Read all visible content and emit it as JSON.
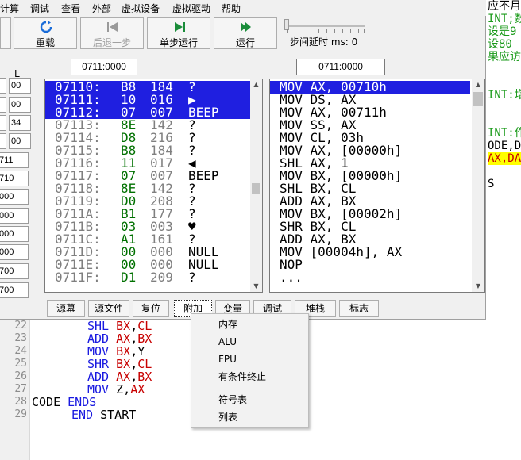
{
  "menubar": {
    "items": [
      "计算",
      "调试",
      "查看",
      "外部",
      "虚拟设备",
      "虚拟驱动",
      "帮助"
    ]
  },
  "toolbar": {
    "reload_label": "重载",
    "step_back_label": "后退一步",
    "step_run_label": "单步运行",
    "run_label": "运行",
    "step_delay_label": "步间延时 ms: 0"
  },
  "address": {
    "memory": "0711:0000",
    "disasm": "0711:0000"
  },
  "registers": {
    "header_l": "L",
    "values_l": [
      "00",
      "00",
      "34",
      "00"
    ],
    "values": [
      "711",
      "710",
      "000",
      "000",
      "000",
      "000",
      "700",
      "700"
    ]
  },
  "memory": {
    "rows": [
      {
        "addr": "07110:",
        "hex": "B8",
        "dec": "184",
        "chr": "?"
      },
      {
        "addr": "07111:",
        "hex": "10",
        "dec": "016",
        "chr": "▶"
      },
      {
        "addr": "07112:",
        "hex": "07",
        "dec": "007",
        "chr": "BEEP"
      },
      {
        "addr": "07113:",
        "hex": "8E",
        "dec": "142",
        "chr": "?"
      },
      {
        "addr": "07114:",
        "hex": "D8",
        "dec": "216",
        "chr": "?"
      },
      {
        "addr": "07115:",
        "hex": "B8",
        "dec": "184",
        "chr": "?"
      },
      {
        "addr": "07116:",
        "hex": "11",
        "dec": "017",
        "chr": "◀"
      },
      {
        "addr": "07117:",
        "hex": "07",
        "dec": "007",
        "chr": "BEEP"
      },
      {
        "addr": "07118:",
        "hex": "8E",
        "dec": "142",
        "chr": "?"
      },
      {
        "addr": "07119:",
        "hex": "D0",
        "dec": "208",
        "chr": "?"
      },
      {
        "addr": "0711A:",
        "hex": "B1",
        "dec": "177",
        "chr": "?"
      },
      {
        "addr": "0711B:",
        "hex": "03",
        "dec": "003",
        "chr": "♥"
      },
      {
        "addr": "0711C:",
        "hex": "A1",
        "dec": "161",
        "chr": "?"
      },
      {
        "addr": "0711D:",
        "hex": "00",
        "dec": "000",
        "chr": "NULL"
      },
      {
        "addr": "0711E:",
        "hex": "00",
        "dec": "000",
        "chr": "NULL"
      },
      {
        "addr": "0711F:",
        "hex": "D1",
        "dec": "209",
        "chr": "?"
      }
    ]
  },
  "disasm": {
    "rows": [
      "MOV AX, 00710h",
      "MOV DS, AX",
      "MOV AX, 00711h",
      "MOV SS, AX",
      "MOV CL, 03h",
      "MOV AX, [00000h]",
      "SHL AX, 1",
      "MOV BX, [00000h]",
      "SHL BX, CL",
      "ADD AX, BX",
      "MOV BX, [00002h]",
      "SHR BX, CL",
      "ADD AX, BX",
      "MOV [00004h], AX",
      "NOP",
      "..."
    ]
  },
  "tabs": [
    "源幕",
    "源文件",
    "复位",
    "附加",
    "变量",
    "调试",
    "堆栈",
    "标志"
  ],
  "dropdown": {
    "items": [
      "内存",
      "ALU",
      "FPU",
      "有条件终止",
      "符号表",
      "列表"
    ]
  },
  "editor": {
    "line_numbers": [
      "22",
      "23",
      "24",
      "25",
      "26",
      "27",
      "28",
      "29"
    ],
    "lines": [
      {
        "k": "SHL",
        "r": "BX",
        "a": ",",
        "b": "CL"
      },
      {
        "k": "ADD",
        "r": "AX",
        "a": ",",
        "b": "BX"
      },
      {
        "k": "MOV",
        "r": "BX",
        "a": ",",
        "b": "Y"
      },
      {
        "k": "SHR",
        "r": "BX",
        "a": ",",
        "b": "CL"
      },
      {
        "k": "ADD",
        "r": "AX",
        "a": ",",
        "b": "BX"
      },
      {
        "k": "MOV",
        "r": "Z",
        "a": ",",
        "b": "AX"
      },
      {
        "k": "CODE",
        "r": "ENDS",
        "a": "",
        "b": ""
      },
      {
        "k": "END",
        "r": "START",
        "a": "",
        "b": ""
      }
    ]
  },
  "right_panel": {
    "lines": [
      "应不月",
      "INT;数",
      "设是9",
      "设80",
      "果应访",
      "",
      "INT:增",
      "",
      "",
      "INT:作",
      "ODE,D",
      "AX,DA",
      "",
      "S"
    ]
  },
  "colors": {
    "selection": "#1f1fe0",
    "green_text": "#007000",
    "keyword": "#1a1ae0",
    "register": "#c80000"
  }
}
